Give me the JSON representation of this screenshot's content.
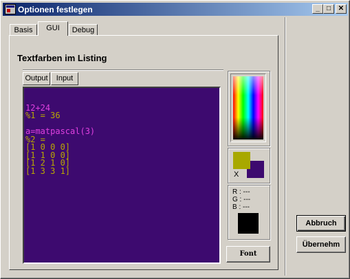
{
  "window": {
    "title": "Optionen festlegen",
    "controls": {
      "minimize": "_",
      "maximize": "□",
      "close": "✕"
    }
  },
  "tabs": [
    {
      "label": "Basis",
      "active": false
    },
    {
      "label": "GUI",
      "active": true
    },
    {
      "label": "Debug",
      "active": false
    }
  ],
  "section": {
    "heading": "Textfarben im Listing"
  },
  "subtabs": [
    {
      "label": "Output",
      "active": true
    },
    {
      "label": "Input",
      "active": false
    }
  ],
  "listing": {
    "background": "#3d0a6f",
    "input_color": "#e040e0",
    "output_color": "#b8a800",
    "lines": [
      {
        "text": "",
        "kind": "out"
      },
      {
        "text": "12+24",
        "kind": "in"
      },
      {
        "text": "%1 = 36",
        "kind": "out"
      },
      {
        "text": "",
        "kind": "out"
      },
      {
        "text": "a=matpascal(3)",
        "kind": "in"
      },
      {
        "text": "%2 =",
        "kind": "out"
      },
      {
        "text": "[1 0 0 0]",
        "kind": "out"
      },
      {
        "text": "[1 1 0 0]",
        "kind": "out"
      },
      {
        "text": "[1 2 1 0]",
        "kind": "out"
      },
      {
        "text": "[1 3 3 1]",
        "kind": "out"
      }
    ]
  },
  "swatches": {
    "foreground": "#a8a800",
    "background": "#3d0a6f",
    "swap_label": "X"
  },
  "rgb": {
    "r": "R : ---",
    "g": "G : ---",
    "b": "B : ---",
    "preview": "#000000"
  },
  "buttons": {
    "font": "Font",
    "cancel": "Abbruch",
    "apply": "Übernehm"
  }
}
